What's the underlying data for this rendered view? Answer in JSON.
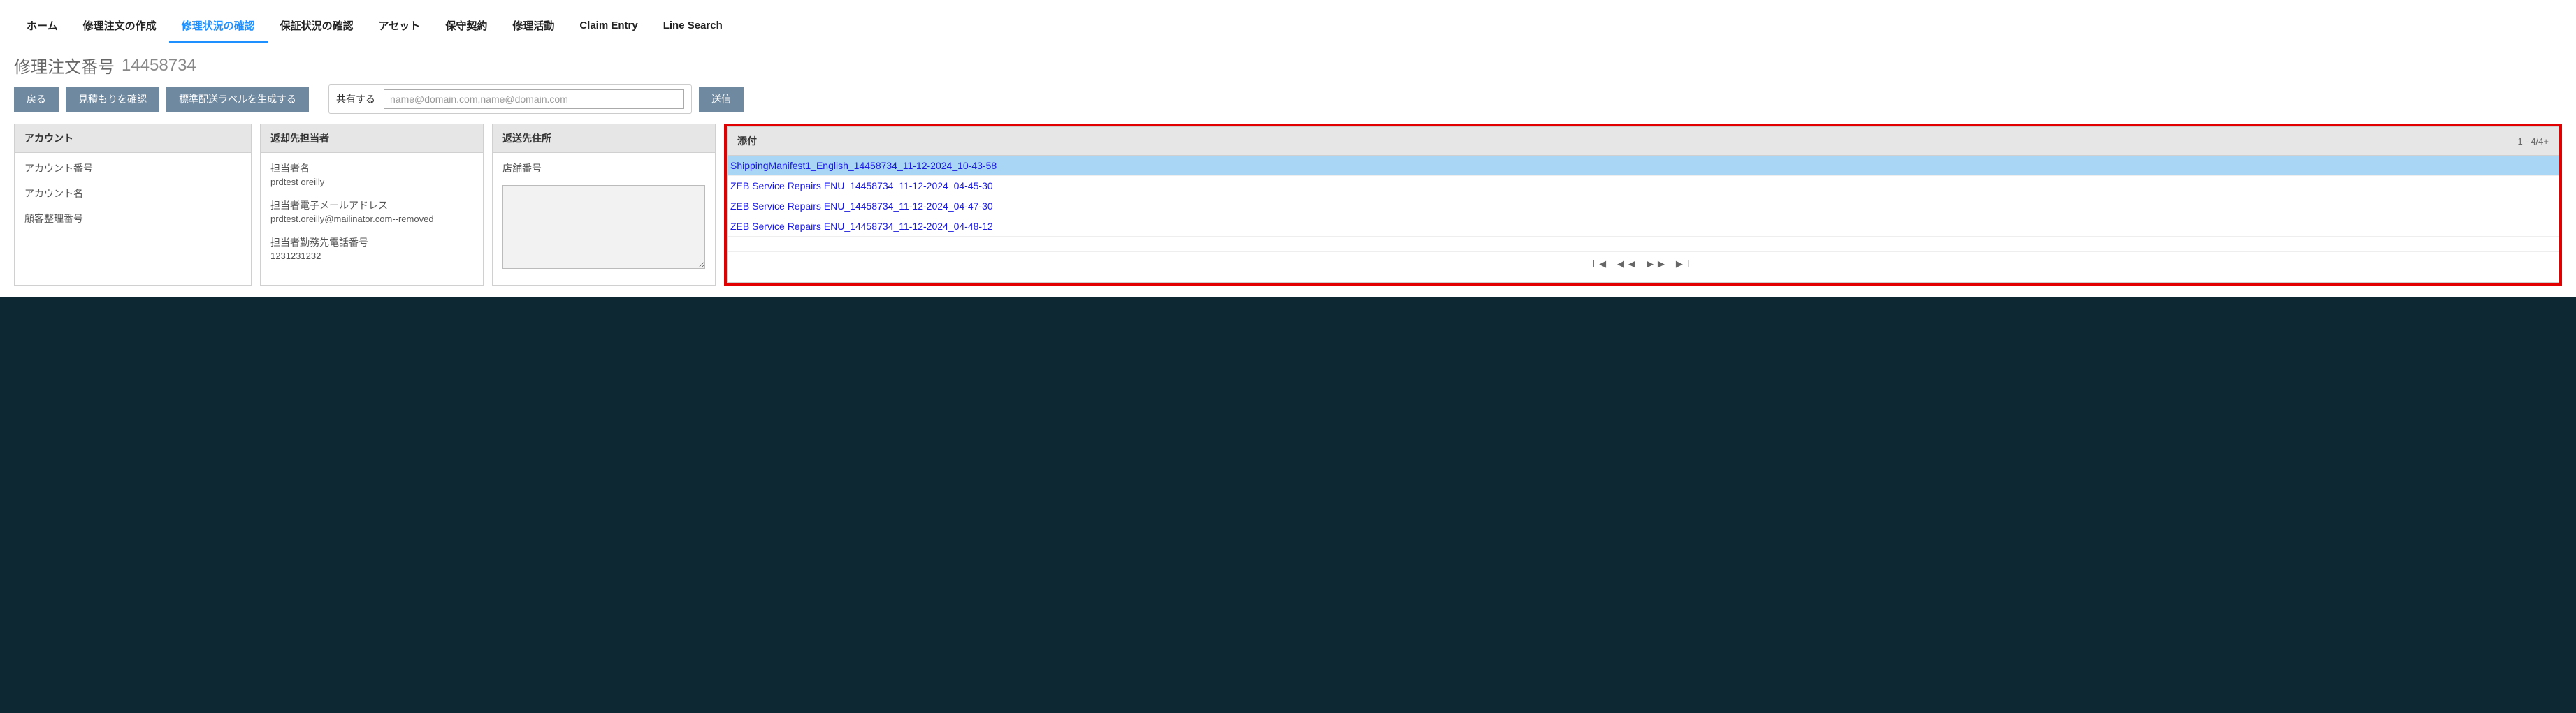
{
  "tabs": {
    "home": "ホーム",
    "create": "修理注文の作成",
    "status": "修理状況の確認",
    "warranty": "保証状況の確認",
    "asset": "アセット",
    "contract": "保守契約",
    "activity": "修理活動",
    "claim": "Claim Entry",
    "line": "Line Search"
  },
  "title": {
    "label": "修理注文番号",
    "number": "14458734"
  },
  "buttons": {
    "back": "戻る",
    "quote": "見積もりを確認",
    "label": "標準配送ラベルを生成する",
    "send": "送信"
  },
  "share": {
    "label": "共有する",
    "placeholder": "name@domain.com,name@domain.com"
  },
  "panels": {
    "account": {
      "title": "アカウント",
      "fields": {
        "num_label": "アカウント番号",
        "name_label": "アカウント名",
        "custref_label": "顧客整理番号"
      }
    },
    "contact": {
      "title": "返却先担当者",
      "fields": {
        "name_label": "担当者名",
        "name_value": "prdtest oreilly",
        "email_label": "担当者電子メールアドレス",
        "email_value": "prdtest.oreilly@mailinator.com--removed",
        "phone_label": "担当者勤務先電話番号",
        "phone_value": "1231231232"
      }
    },
    "ship": {
      "title": "返送先住所",
      "store_label": "店舗番号"
    },
    "attach": {
      "title": "添付",
      "count": "1 - 4/4+",
      "items": [
        "ShippingManifest1_English_14458734_11-12-2024_10-43-58",
        "ZEB Service Repairs ENU_14458734_11-12-2024_04-45-30",
        "ZEB Service Repairs ENU_14458734_11-12-2024_04-47-30",
        "ZEB Service Repairs ENU_14458734_11-12-2024_04-48-12"
      ]
    }
  },
  "pager": {
    "first": "⏮",
    "prev": "◀◀",
    "next": "▶▶",
    "last": "⏭"
  }
}
